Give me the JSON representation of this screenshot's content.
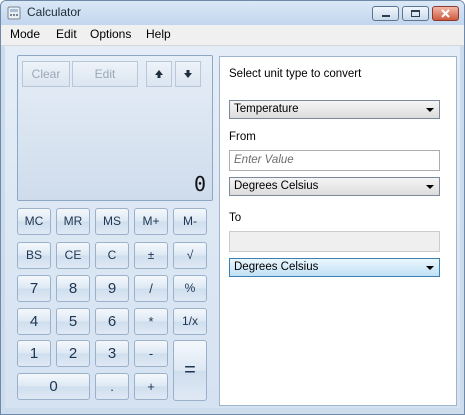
{
  "window": {
    "title": "Calculator"
  },
  "menu": [
    "Mode",
    "Edit",
    "Options",
    "Help"
  ],
  "calc": {
    "top_buttons": {
      "clear": "Clear",
      "edit": "Edit"
    },
    "display": "0",
    "memory_row": [
      "MC",
      "MR",
      "MS",
      "M+",
      "M-"
    ],
    "row2": [
      "BS",
      "CE",
      "C",
      "±",
      "√"
    ],
    "row3": [
      "7",
      "8",
      "9",
      "/",
      "%"
    ],
    "row4": [
      "4",
      "5",
      "6",
      "*",
      "1/x"
    ],
    "row5": [
      "1",
      "2",
      "3",
      "-",
      "="
    ],
    "row6": [
      "0",
      ".",
      "+"
    ]
  },
  "converter": {
    "heading": "Select unit type to convert",
    "unit_type": "Temperature",
    "from_label": "From",
    "from_placeholder": "Enter Value",
    "from_unit": "Degrees Celsius",
    "to_label": "To",
    "to_value": "",
    "to_unit": "Degrees Celsius"
  }
}
